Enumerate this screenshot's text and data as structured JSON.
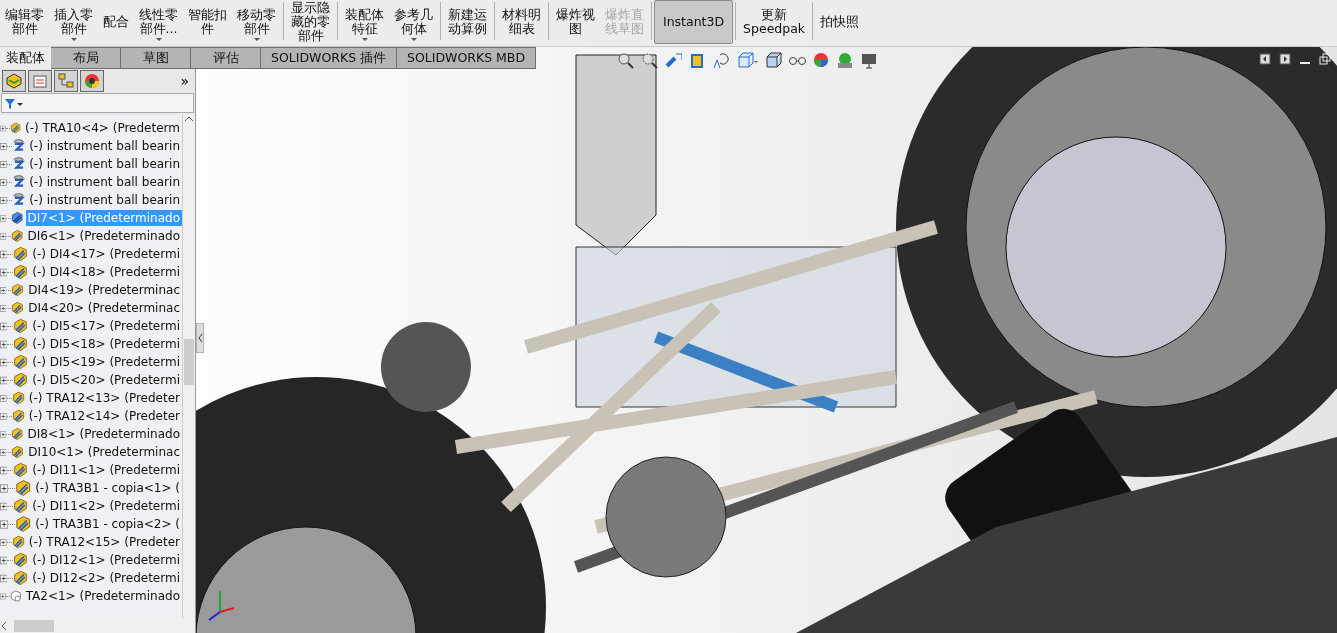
{
  "toolbar": {
    "buttons": [
      {
        "lines": [
          "编辑零",
          "部件"
        ],
        "has_menu": false,
        "disabled": false,
        "selected": false
      },
      {
        "lines": [
          "插入零",
          "部件"
        ],
        "has_menu": true,
        "disabled": false,
        "selected": false
      },
      {
        "lines": [
          "配合"
        ],
        "has_menu": false,
        "disabled": false,
        "selected": false
      },
      {
        "lines": [
          "线性零",
          "部件..."
        ],
        "has_menu": true,
        "disabled": false,
        "selected": false
      },
      {
        "lines": [
          "智能扣",
          "件"
        ],
        "has_menu": false,
        "disabled": false,
        "selected": false
      },
      {
        "lines": [
          "移动零",
          "部件"
        ],
        "has_menu": true,
        "disabled": false,
        "selected": false
      },
      {
        "lines": [
          "显示隐",
          "藏的零",
          "部件"
        ],
        "has_menu": false,
        "disabled": false,
        "selected": false
      },
      {
        "lines": [
          "装配体",
          "特征"
        ],
        "has_menu": true,
        "disabled": false,
        "selected": false
      },
      {
        "lines": [
          "参考几",
          "何体"
        ],
        "has_menu": true,
        "disabled": false,
        "selected": false
      },
      {
        "lines": [
          "新建运",
          "动算例"
        ],
        "has_menu": false,
        "disabled": false,
        "selected": false
      },
      {
        "lines": [
          "材料明",
          "细表"
        ],
        "has_menu": false,
        "disabled": false,
        "selected": false
      },
      {
        "lines": [
          "爆炸视",
          "图"
        ],
        "has_menu": false,
        "disabled": false,
        "selected": false
      },
      {
        "lines": [
          "爆炸直",
          "线草图"
        ],
        "has_menu": false,
        "disabled": true,
        "selected": false
      },
      {
        "lines": [
          "Instant3D"
        ],
        "has_menu": false,
        "disabled": false,
        "selected": true
      },
      {
        "lines": [
          "更新",
          "Speedpak"
        ],
        "has_menu": false,
        "disabled": false,
        "selected": false
      },
      {
        "lines": [
          "拍快照"
        ],
        "has_menu": false,
        "disabled": false,
        "selected": false
      }
    ]
  },
  "command_tabs": [
    {
      "label": "装配体",
      "selected": true
    },
    {
      "label": "布局",
      "selected": false
    },
    {
      "label": "草图",
      "selected": false
    },
    {
      "label": "评估",
      "selected": false
    },
    {
      "label": "SOLIDWORKS 插件",
      "selected": false
    },
    {
      "label": "SOLIDWORKS MBD",
      "selected": false
    }
  ],
  "panel": {
    "more": "»"
  },
  "tree": [
    {
      "text": "(-) TRA10<4> (Predeterm",
      "kind": "part",
      "selected": false,
      "expanded": false
    },
    {
      "text": "(-) instrument ball bearin",
      "kind": "bearing",
      "selected": false,
      "expanded": false
    },
    {
      "text": "(-) instrument ball bearin",
      "kind": "bearing",
      "selected": false,
      "expanded": false
    },
    {
      "text": "(-) instrument ball bearin",
      "kind": "bearing",
      "selected": false,
      "expanded": false
    },
    {
      "text": "(-) instrument ball bearin",
      "kind": "bearing",
      "selected": false,
      "expanded": false
    },
    {
      "text": "DI7<1> (Predeterminado",
      "kind": "part",
      "selected": true,
      "expanded": false
    },
    {
      "text": "DI6<1> (Predeterminado",
      "kind": "part",
      "selected": false,
      "expanded": false
    },
    {
      "text": "(-) DI4<17> (Predetermi",
      "kind": "part",
      "selected": false,
      "expanded": false
    },
    {
      "text": "(-) DI4<18> (Predetermi",
      "kind": "part",
      "selected": false,
      "expanded": false
    },
    {
      "text": "DI4<19> (Predeterminac",
      "kind": "part",
      "selected": false,
      "expanded": false
    },
    {
      "text": "DI4<20> (Predeterminac",
      "kind": "part",
      "selected": false,
      "expanded": false
    },
    {
      "text": "(-) DI5<17> (Predetermi",
      "kind": "part",
      "selected": false,
      "expanded": false
    },
    {
      "text": "(-) DI5<18> (Predetermi",
      "kind": "part",
      "selected": false,
      "expanded": false
    },
    {
      "text": "(-) DI5<19> (Predetermi",
      "kind": "part",
      "selected": false,
      "expanded": false
    },
    {
      "text": "(-) DI5<20> (Predetermi",
      "kind": "part",
      "selected": false,
      "expanded": false
    },
    {
      "text": "(-) TRA12<13> (Predeter",
      "kind": "part",
      "selected": false,
      "expanded": false
    },
    {
      "text": "(-) TRA12<14> (Predeter",
      "kind": "part",
      "selected": false,
      "expanded": false
    },
    {
      "text": "DI8<1> (Predeterminado",
      "kind": "part",
      "selected": false,
      "expanded": false
    },
    {
      "text": "DI10<1> (Predeterminac",
      "kind": "part",
      "selected": false,
      "expanded": false
    },
    {
      "text": "(-) DI11<1> (Predetermi",
      "kind": "part",
      "selected": false,
      "expanded": false
    },
    {
      "text": "(-) TRA3B1 - copia<1> (",
      "kind": "part",
      "selected": false,
      "expanded": false
    },
    {
      "text": "(-) DI11<2> (Predetermi",
      "kind": "part",
      "selected": false,
      "expanded": false
    },
    {
      "text": "(-) TRA3B1 - copia<2> (",
      "kind": "part",
      "selected": false,
      "expanded": false
    },
    {
      "text": "(-) TRA12<15> (Predeter",
      "kind": "part",
      "selected": false,
      "expanded": false
    },
    {
      "text": "(-) DI12<1> (Predetermi",
      "kind": "part",
      "selected": false,
      "expanded": false
    },
    {
      "text": "(-) DI12<2> (Predetermi",
      "kind": "part",
      "selected": false,
      "expanded": false
    },
    {
      "text": "TA2<1> (Predeterminado",
      "kind": "virtual",
      "selected": false,
      "expanded": false
    }
  ]
}
